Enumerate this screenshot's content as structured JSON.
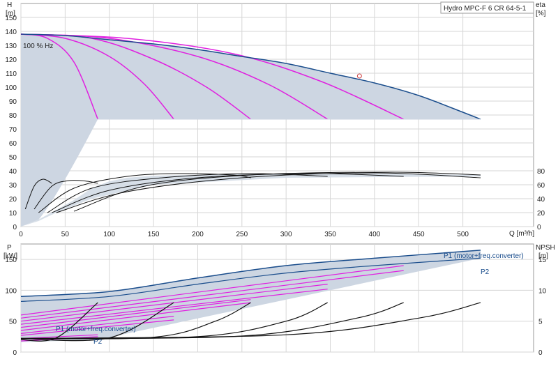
{
  "chart_data": [
    {
      "type": "line",
      "title": "Hydro MPC-F 6 CR 64-5-1",
      "xlabel": "Q [m³/h]",
      "ylabel_left": "H",
      "ylabel_left_unit": "[m]",
      "ylabel_right": "eta",
      "ylabel_right_unit": "[%]",
      "xlim": [
        0,
        580
      ],
      "ylim": [
        0,
        160
      ],
      "eta_lim": [
        0,
        100
      ],
      "x_ticks": [
        "0",
        "50",
        "100",
        "150",
        "200",
        "250",
        "300",
        "350",
        "400",
        "450",
        "500"
      ],
      "y_ticks": [
        "0",
        "10",
        "20",
        "30",
        "40",
        "50",
        "60",
        "70",
        "80",
        "90",
        "100",
        "110",
        "120",
        "130",
        "140",
        "150"
      ],
      "eta_ticks": [
        "0",
        "20",
        "40",
        "60",
        "80"
      ],
      "annotation": "100 % Hz",
      "duty_point": {
        "q": 383,
        "h": 108
      },
      "min_head": 77,
      "qh_100": [
        [
          0,
          138
        ],
        [
          50,
          137
        ],
        [
          100,
          134
        ],
        [
          150,
          131
        ],
        [
          200,
          127
        ],
        [
          250,
          122
        ],
        [
          300,
          117
        ],
        [
          350,
          110
        ],
        [
          400,
          103
        ],
        [
          450,
          94
        ],
        [
          500,
          82
        ],
        [
          520,
          77
        ]
      ],
      "qh_partial": [
        [
          [
            0,
            138
          ],
          [
            30,
            135
          ],
          [
            60,
            118
          ],
          [
            87,
            77
          ]
        ],
        [
          [
            0,
            138
          ],
          [
            50,
            135
          ],
          [
            100,
            122
          ],
          [
            140,
            102
          ],
          [
            173,
            77
          ]
        ],
        [
          [
            0,
            138
          ],
          [
            80,
            135
          ],
          [
            150,
            120
          ],
          [
            210,
            100
          ],
          [
            260,
            77
          ]
        ],
        [
          [
            0,
            138
          ],
          [
            100,
            135
          ],
          [
            200,
            122
          ],
          [
            280,
            102
          ],
          [
            347,
            77
          ]
        ],
        [
          [
            0,
            138
          ],
          [
            120,
            135
          ],
          [
            240,
            124
          ],
          [
            340,
            104
          ],
          [
            433,
            77
          ]
        ]
      ],
      "eta_curves": [
        [
          [
            5,
            25
          ],
          [
            15,
            58
          ],
          [
            25,
            68
          ],
          [
            35,
            62
          ]
        ],
        [
          [
            15,
            25
          ],
          [
            35,
            58
          ],
          [
            55,
            66
          ],
          [
            75,
            65
          ],
          [
            87,
            62
          ]
        ],
        [
          [
            20,
            20
          ],
          [
            60,
            55
          ],
          [
            120,
            72
          ],
          [
            180,
            76
          ],
          [
            240,
            74
          ],
          [
            260,
            70
          ]
        ],
        [
          [
            30,
            20
          ],
          [
            80,
            55
          ],
          [
            160,
            70
          ],
          [
            260,
            76
          ],
          [
            347,
            72
          ]
        ],
        [
          [
            35,
            20
          ],
          [
            100,
            52
          ],
          [
            200,
            70
          ],
          [
            330,
            76
          ],
          [
            433,
            72
          ]
        ],
        [
          [
            40,
            20
          ],
          [
            120,
            50
          ],
          [
            250,
            70
          ],
          [
            400,
            77
          ],
          [
            520,
            70
          ]
        ],
        [
          [
            60,
            22
          ],
          [
            140,
            58
          ],
          [
            260,
            74
          ],
          [
            420,
            78
          ],
          [
            520,
            74
          ]
        ]
      ],
      "envelope_low": [
        [
          0,
          0
        ],
        [
          10,
          5
        ],
        [
          20,
          10
        ],
        [
          40,
          24
        ],
        [
          60,
          38
        ],
        [
          80,
          55
        ],
        [
          100,
          65
        ],
        [
          120,
          70
        ],
        [
          150,
          73
        ],
        [
          220,
          75
        ],
        [
          300,
          76
        ],
        [
          400,
          76
        ],
        [
          520,
          74
        ],
        [
          520,
          72
        ],
        [
          300,
          70
        ],
        [
          150,
          60
        ],
        [
          80,
          40
        ],
        [
          40,
          20
        ],
        [
          20,
          8
        ],
        [
          0,
          0
        ]
      ]
    },
    {
      "type": "line",
      "xlim": [
        0,
        580
      ],
      "ylabel_left": "P",
      "ylabel_left_unit": "[kW]",
      "ylabel_right": "NPSH",
      "ylabel_right_unit": "[m]",
      "ylim": [
        0,
        175
      ],
      "npsh_lim": [
        0,
        17.5
      ],
      "y_ticks": [
        "0",
        "50",
        "100",
        "150"
      ],
      "npsh_ticks": [
        "0",
        "5",
        "10",
        "15"
      ],
      "series_labels": {
        "p1_top": "P1 (motor+freq.converter)",
        "p2_top": "P2",
        "p1_low": "P1 (motor+freq.converter)",
        "p2_low": "P2"
      },
      "p1_100": [
        [
          0,
          90
        ],
        [
          100,
          98
        ],
        [
          200,
          120
        ],
        [
          300,
          140
        ],
        [
          400,
          152
        ],
        [
          520,
          165
        ]
      ],
      "p2_100": [
        [
          0,
          82
        ],
        [
          100,
          90
        ],
        [
          200,
          110
        ],
        [
          300,
          128
        ],
        [
          400,
          140
        ],
        [
          520,
          152
        ]
      ],
      "power_partial": [
        [
          [
            0,
            60
          ],
          [
            433,
            140
          ]
        ],
        [
          [
            0,
            55
          ],
          [
            433,
            132
          ]
        ],
        [
          [
            0,
            50
          ],
          [
            347,
            110
          ]
        ],
        [
          [
            0,
            45
          ],
          [
            347,
            102
          ]
        ],
        [
          [
            0,
            40
          ],
          [
            260,
            85
          ]
        ],
        [
          [
            0,
            35
          ],
          [
            260,
            80
          ]
        ],
        [
          [
            0,
            30
          ],
          [
            173,
            58
          ]
        ],
        [
          [
            0,
            27
          ],
          [
            173,
            52
          ]
        ],
        [
          [
            0,
            22
          ],
          [
            87,
            28
          ]
        ],
        [
          [
            0,
            18
          ],
          [
            87,
            25
          ]
        ]
      ],
      "npsh_curves": [
        [
          [
            0,
            2
          ],
          [
            40,
            2.3
          ],
          [
            87,
            8
          ]
        ],
        [
          [
            0,
            2.2
          ],
          [
            100,
            2.3
          ],
          [
            173,
            8
          ]
        ],
        [
          [
            0,
            2.2
          ],
          [
            150,
            2.4
          ],
          [
            220,
            5
          ],
          [
            260,
            8
          ]
        ],
        [
          [
            0,
            2.2
          ],
          [
            200,
            2.5
          ],
          [
            300,
            5
          ],
          [
            347,
            8
          ]
        ],
        [
          [
            0,
            2.2
          ],
          [
            250,
            2.6
          ],
          [
            380,
            5.5
          ],
          [
            433,
            8
          ]
        ],
        [
          [
            0,
            2.2
          ],
          [
            300,
            2.8
          ],
          [
            450,
            5.5
          ],
          [
            520,
            8
          ]
        ]
      ]
    }
  ]
}
